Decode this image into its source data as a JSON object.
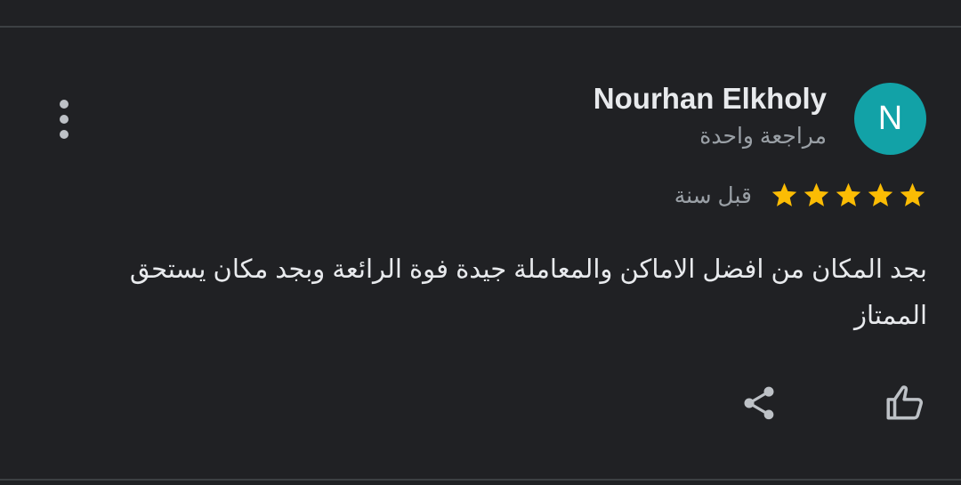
{
  "review": {
    "reviewer_name": "Nourhan Elkholy",
    "avatar_initial": "N",
    "review_count": "مراجعة واحدة",
    "rating": 5,
    "rating_max": 5,
    "time_ago": "قبل سنة",
    "text": "بجد المكان من افضل الاماكن والمعاملة جيدة فوة الرائعة وبجد مكان يستحق الممتاز"
  },
  "colors": {
    "background": "#202124",
    "avatar_bg": "#12a2a7",
    "star": "#fbbc04",
    "primary_text": "#e8eaed",
    "secondary_text": "#9aa0a6",
    "icon": "#bdc1c6"
  },
  "icons": {
    "more": "more-vert-icon",
    "star": "star-icon",
    "share": "share-icon",
    "like": "thumb-up-icon"
  }
}
